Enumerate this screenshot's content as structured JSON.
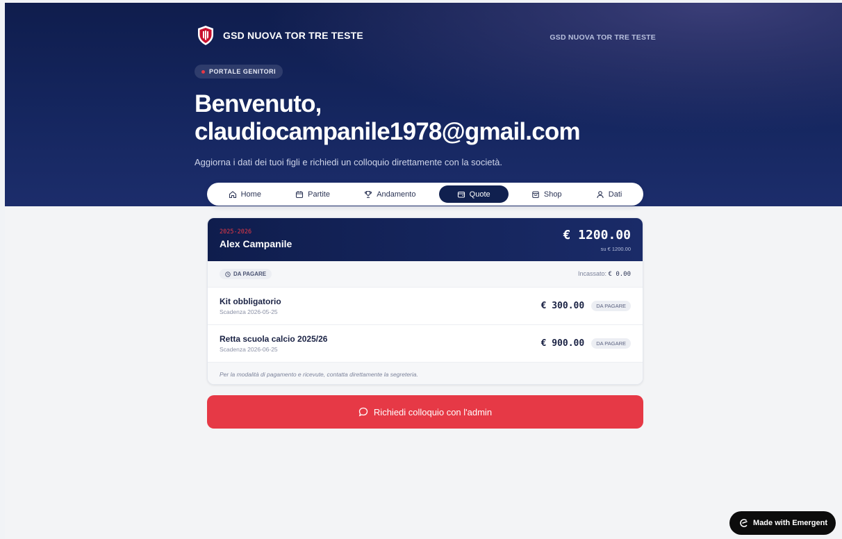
{
  "header": {
    "brand_name": "GSD NUOVA TOR TRE TESTE",
    "brand_right": "GSD NUOVA TOR TRE TESTE",
    "portal_badge": "PORTALE GENITORI",
    "welcome_line1": "Benvenuto,",
    "welcome_line2": "claudiocampanile1978@gmail.com",
    "subtitle": "Aggiorna i dati dei tuoi figli e richiedi un colloquio direttamente con la società."
  },
  "nav": {
    "items": [
      {
        "label": "Home",
        "icon": "home-icon"
      },
      {
        "label": "Partite",
        "icon": "calendar-icon"
      },
      {
        "label": "Andamento",
        "icon": "trophy-icon"
      },
      {
        "label": "Quote",
        "icon": "wallet-icon"
      },
      {
        "label": "Shop",
        "icon": "bag-icon"
      },
      {
        "label": "Dati",
        "icon": "user-icon"
      }
    ],
    "active": "Quote"
  },
  "fee_card": {
    "season": "2025-2026",
    "child_name": "Alex Campanile",
    "total": "€ 1200.00",
    "total_sub": "su € 1200.00",
    "status": "DA PAGARE",
    "incassato_label": "Incassato:",
    "incassato_value": "€ 0.00",
    "items": [
      {
        "title": "Kit obbligatorio",
        "due": "Scadenza 2026-05-25",
        "amount": "€ 300.00",
        "status": "DA PAGARE"
      },
      {
        "title": "Retta scuola calcio 2025/26",
        "due": "Scadenza 2026-06-25",
        "amount": "€ 900.00",
        "status": "DA PAGARE"
      }
    ],
    "note": "Per la modalità di pagamento e ricevute, contatta direttamente la segreteria."
  },
  "cta": {
    "label": "Richiedi colloquio con l'admin"
  },
  "badge": {
    "label": "Made with Emergent"
  },
  "colors": {
    "navy": "#10204f",
    "accent_red": "#e63946"
  }
}
